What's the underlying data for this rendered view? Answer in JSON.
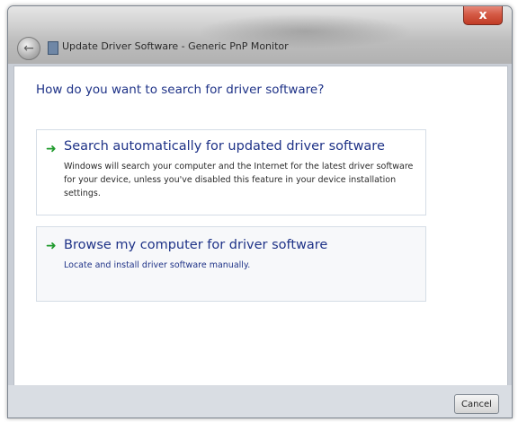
{
  "window": {
    "title": "Update Driver Software - Generic PnP Monitor",
    "close_glyph": "x"
  },
  "content": {
    "heading": "How do you want to search for driver software?",
    "options": [
      {
        "title": "Search automatically for updated driver software",
        "description": "Windows will search your computer and the Internet for the latest driver software for your device, unless you've disabled this feature in your device installation settings.",
        "icon": "green-arrow-icon"
      },
      {
        "title": "Browse my computer for driver software",
        "description": "Locate and install driver software manually.",
        "icon": "green-arrow-icon"
      }
    ]
  },
  "footer": {
    "cancel_label": "Cancel"
  },
  "colors": {
    "link_blue": "#1e3287",
    "arrow_green": "#1f9a2c",
    "close_red": "#c13b25"
  }
}
